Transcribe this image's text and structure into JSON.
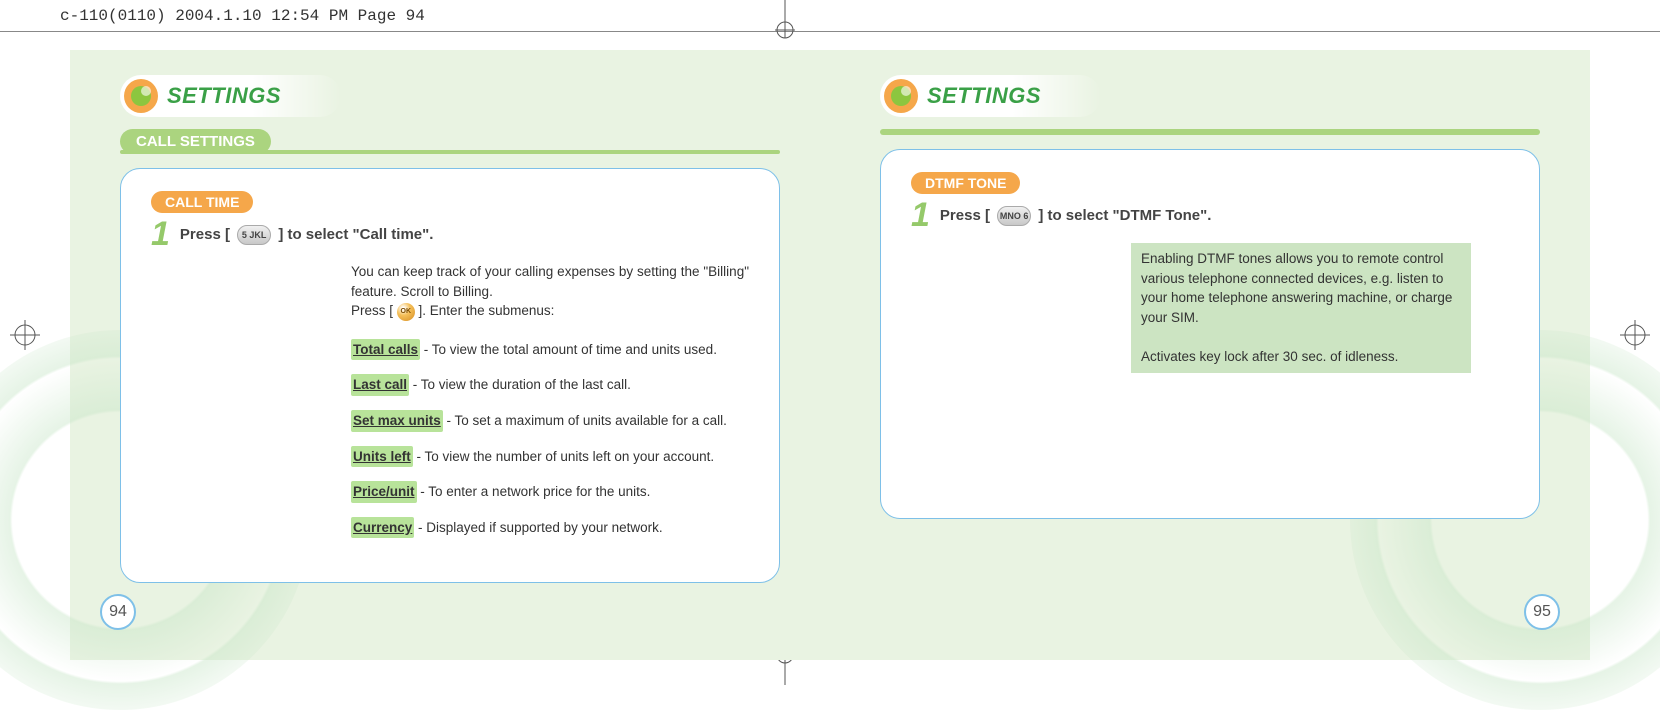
{
  "header": {
    "file_info": "c-110(0110)  2004.1.10  12:54 PM  Page 94"
  },
  "left": {
    "title": "SETTINGS",
    "subsection": "CALL SETTINGS",
    "box_title": "CALL TIME",
    "step_prefix": "Press [",
    "key_label": "5 JKL",
    "step_suffix": "] to select \"Call time\".",
    "intro_line1": "You can keep track of your calling expenses by setting the \"Billing\" feature. Scroll to Billing.",
    "intro_line2_a": "Press [",
    "ok_label": "OK",
    "intro_line2_b": "]. Enter the submenus:",
    "items": [
      {
        "label": "Total calls",
        "desc": " - To view the total amount of  time and units used."
      },
      {
        "label": "Last call",
        "desc": " - To view the duration of the last call."
      },
      {
        "label": "Set max units",
        "desc": " - To set a maximum of units available for a call."
      },
      {
        "label": "Units left",
        "desc": " - To view the number of units left on your account."
      },
      {
        "label": "Price/unit",
        "desc": " - To enter a network price for the units."
      },
      {
        "label": "Currency",
        "desc": " - Displayed if supported by your network."
      }
    ],
    "page_num": "94"
  },
  "right": {
    "title": "SETTINGS",
    "box_title": "DTMF TONE",
    "step_prefix": "Press [",
    "key_label": "MNO 6",
    "step_suffix": "] to select \"DTMF Tone\".",
    "para1": "Enabling DTMF tones allows you to remote control various telephone connected devices, e.g. listen to your home telephone answering machine, or charge your SIM.",
    "para2": "Activates key lock after 30 sec. of idleness.",
    "page_num": "95"
  }
}
